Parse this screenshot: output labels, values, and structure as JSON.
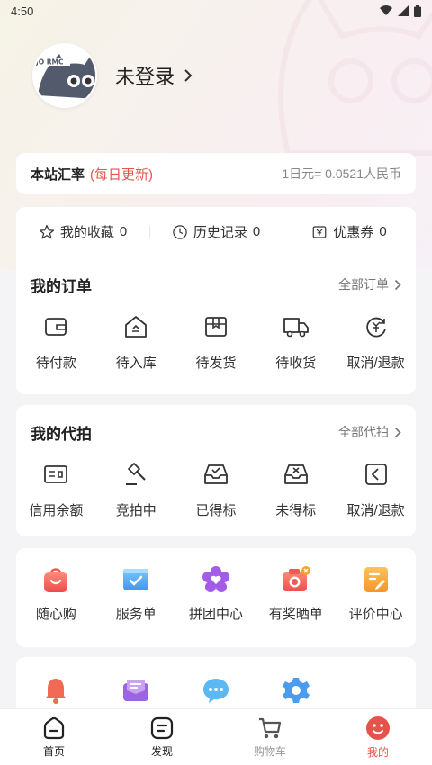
{
  "status_bar": {
    "time": "4:50"
  },
  "profile": {
    "login_label": "未登录"
  },
  "rate": {
    "title": "本站汇率",
    "note": "(每日更新)",
    "value": "1日元= 0.0521人民币"
  },
  "stats": [
    {
      "icon": "star-icon",
      "label": "我的收藏",
      "count": "0"
    },
    {
      "icon": "clock-icon",
      "label": "历史记录",
      "count": "0"
    },
    {
      "icon": "coupon-icon",
      "label": "优惠券",
      "count": "0"
    }
  ],
  "orders": {
    "title": "我的订单",
    "more": "全部订单",
    "items": [
      {
        "icon": "wallet-icon",
        "label": "待付款"
      },
      {
        "icon": "warehouse-icon",
        "label": "待入库"
      },
      {
        "icon": "package-icon",
        "label": "待发货"
      },
      {
        "icon": "truck-icon",
        "label": "待收货"
      },
      {
        "icon": "refund-icon",
        "label": "取消/退款"
      }
    ]
  },
  "bids": {
    "title": "我的代拍",
    "more": "全部代拍",
    "items": [
      {
        "icon": "id-card-icon",
        "label": "信用余额"
      },
      {
        "icon": "gavel-icon",
        "label": "竞拍中"
      },
      {
        "icon": "inbox-check-icon",
        "label": "已得标"
      },
      {
        "icon": "inbox-x-icon",
        "label": "未得标"
      },
      {
        "icon": "return-icon",
        "label": "取消/退款"
      }
    ]
  },
  "services": [
    {
      "icon": "shopping-bag-icon",
      "label": "随心购",
      "color": "#f0625a"
    },
    {
      "icon": "checklist-icon",
      "label": "服务单",
      "color": "#49a4f0"
    },
    {
      "icon": "group-buy-icon",
      "label": "拼团中心",
      "color": "#a35ce8"
    },
    {
      "icon": "camera-reward-icon",
      "label": "有奖晒单",
      "color": "#f27065"
    },
    {
      "icon": "review-icon",
      "label": "评价中心",
      "color": "#f5a12f"
    }
  ],
  "more_services": [
    {
      "icon": "bell-icon",
      "color": "#f26a55"
    },
    {
      "icon": "mail-icon",
      "color": "#9b64e0"
    },
    {
      "icon": "chat-icon",
      "color": "#5bb8f2"
    },
    {
      "icon": "settings-icon",
      "color": "#4a9cf0"
    }
  ],
  "tabs": [
    {
      "icon": "home-icon",
      "label": "首页"
    },
    {
      "icon": "discover-icon",
      "label": "发现"
    },
    {
      "icon": "cart-icon",
      "label": "购物车"
    },
    {
      "icon": "mine-icon",
      "label": "我的"
    }
  ],
  "colors": {
    "accent": "#e5534b"
  }
}
